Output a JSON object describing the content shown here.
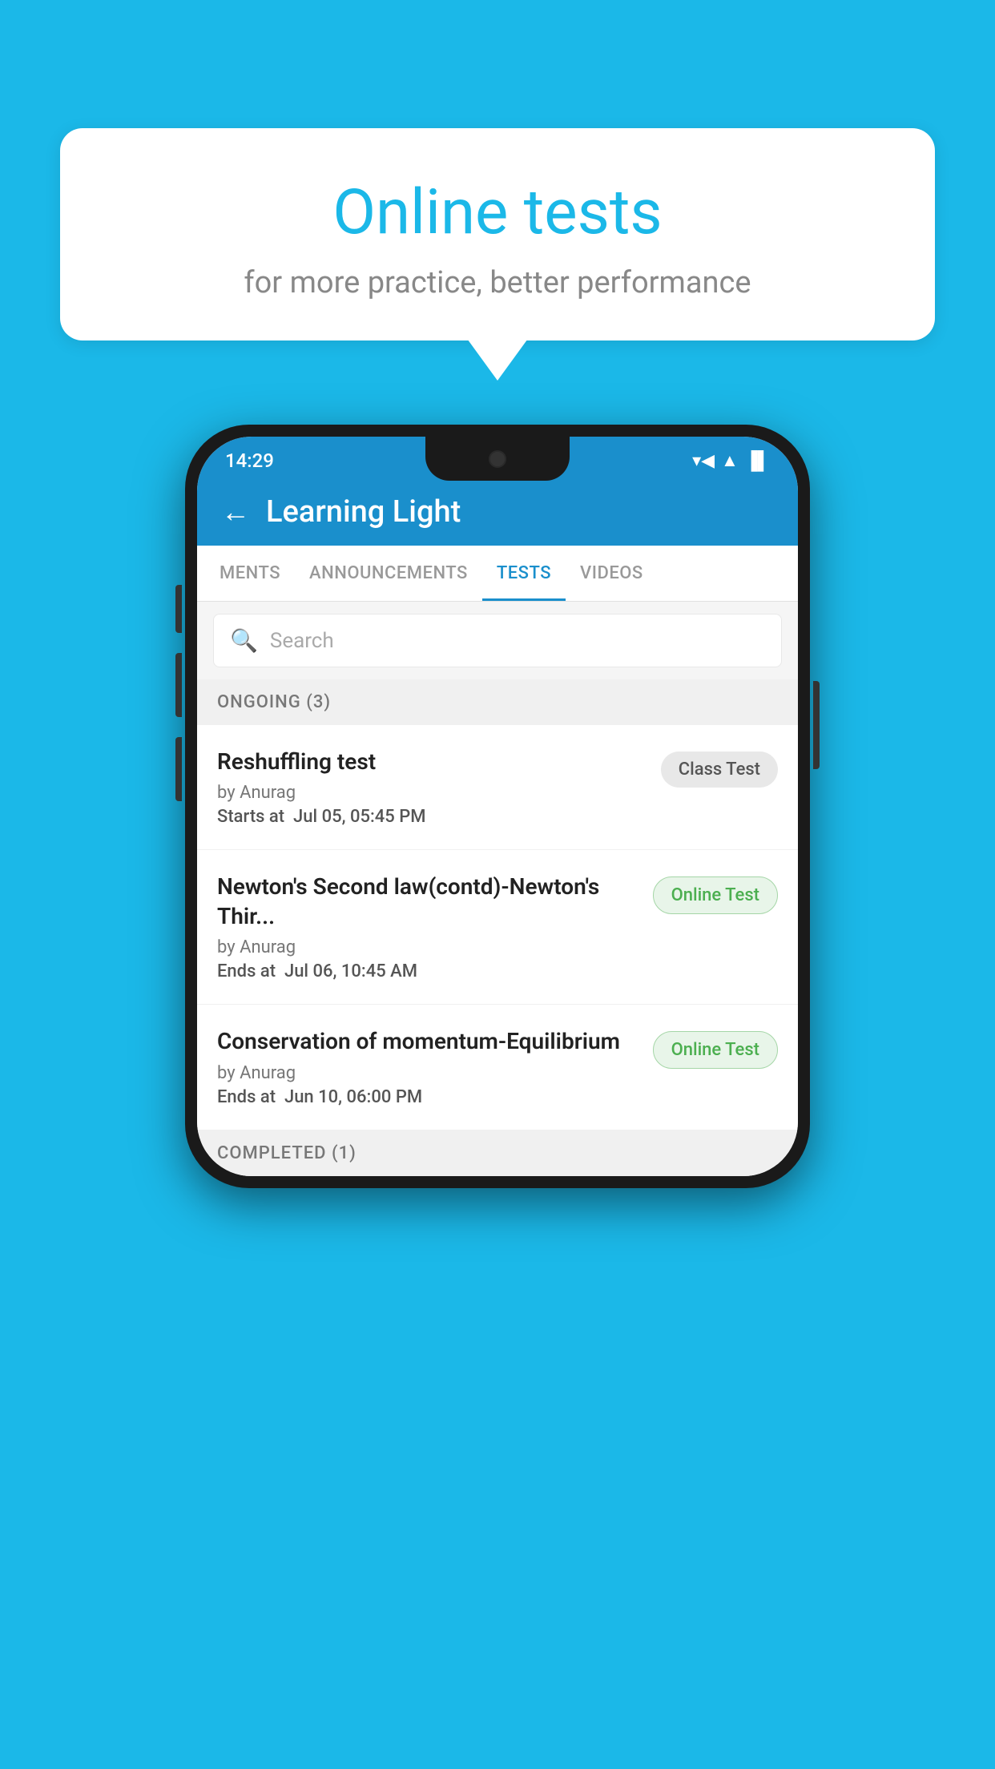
{
  "background": {
    "color": "#1bb8e8"
  },
  "speech_bubble": {
    "title": "Online tests",
    "subtitle": "for more practice, better performance"
  },
  "phone": {
    "status_bar": {
      "time": "14:29",
      "wifi": "▼",
      "signal": "▲",
      "battery": "▐"
    },
    "header": {
      "back_label": "←",
      "title": "Learning Light"
    },
    "tabs": [
      {
        "label": "MENTS",
        "active": false
      },
      {
        "label": "ANNOUNCEMENTS",
        "active": false
      },
      {
        "label": "TESTS",
        "active": true
      },
      {
        "label": "VIDEOS",
        "active": false
      }
    ],
    "search": {
      "placeholder": "Search"
    },
    "ongoing_section": {
      "label": "ONGOING (3)"
    },
    "tests": [
      {
        "name": "Reshuffling test",
        "author": "by Anurag",
        "time_label": "Starts at",
        "time_value": "Jul 05, 05:45 PM",
        "badge": "Class Test",
        "badge_type": "class"
      },
      {
        "name": "Newton's Second law(contd)-Newton's Thir...",
        "author": "by Anurag",
        "time_label": "Ends at",
        "time_value": "Jul 06, 10:45 AM",
        "badge": "Online Test",
        "badge_type": "online"
      },
      {
        "name": "Conservation of momentum-Equilibrium",
        "author": "by Anurag",
        "time_label": "Ends at",
        "time_value": "Jun 10, 06:00 PM",
        "badge": "Online Test",
        "badge_type": "online"
      }
    ],
    "completed_section": {
      "label": "COMPLETED (1)"
    }
  }
}
